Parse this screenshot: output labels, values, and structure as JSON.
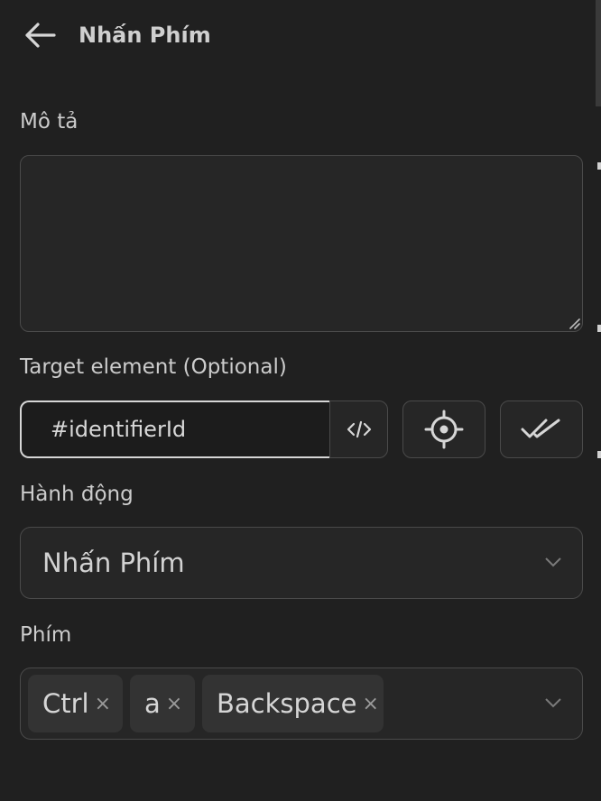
{
  "header": {
    "title": "Nhấn Phím"
  },
  "description": {
    "label": "Mô tả",
    "value": ""
  },
  "target": {
    "label": "Target element (Optional)",
    "value": "#identifierId",
    "code_icon": "code-icon",
    "pick_icon": "crosshair-icon",
    "verify_icon": "double-check-icon"
  },
  "action": {
    "label": "Hành động",
    "selected": "Nhấn Phím"
  },
  "keys": {
    "label": "Phím",
    "chips": [
      "Ctrl",
      "a",
      "Backspace"
    ],
    "remove_glyph": "×"
  }
}
